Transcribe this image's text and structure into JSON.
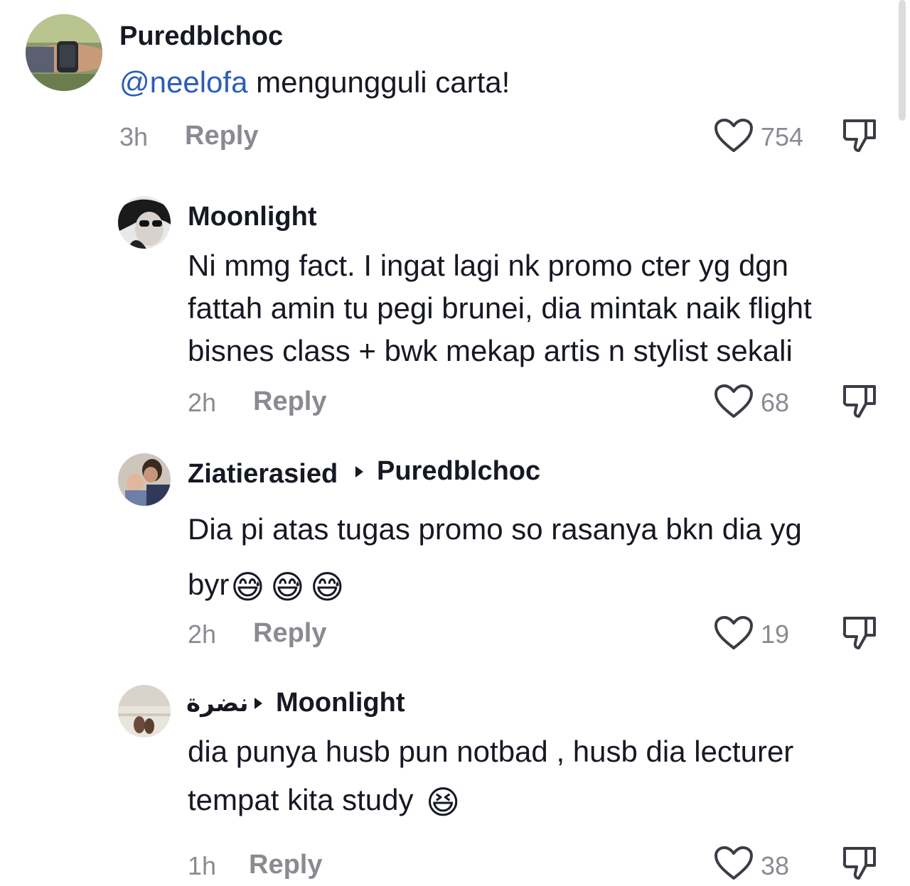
{
  "comments": [
    {
      "username": "Puredblchoc",
      "mention": "@neelofa",
      "text": " mengungguli carta!",
      "time": "3h",
      "reply_label": "Reply",
      "likes": "754",
      "avatar_icon": "watch-wrist-photo"
    },
    {
      "username": "Moonlight",
      "lines": [
        "Ni mmg fact. I ingat lagi nk promo cter yg dgn",
        "fattah amin tu pegi brunei, dia mintak naik flight",
        "bisnes class + bwk mekap artis n stylist sekali"
      ],
      "time": "2h",
      "reply_label": "Reply",
      "likes": "68",
      "avatar_icon": "woman-sunglasses-photo"
    },
    {
      "username": "Ziatierasied",
      "reply_to": "Puredblchoc",
      "lines": [
        "Dia pi atas tugas promo so rasanya bkn dia yg",
        "byr"
      ],
      "emoji": "😅😅😅",
      "time": "2h",
      "reply_label": "Reply",
      "likes": "19",
      "avatar_icon": "family-photo"
    },
    {
      "username": "نضرة",
      "reply_to": "Moonlight",
      "lines": [
        "dia punya husb pun notbad , husb dia lecturer",
        "tempat kita study "
      ],
      "emoji": "😆",
      "time": "1h",
      "reply_label": "Reply",
      "likes": "38",
      "avatar_icon": "beach-feet-photo"
    }
  ],
  "colors": {
    "text": "#161823",
    "muted": "#8a8b91",
    "mention": "#2b5db9"
  }
}
